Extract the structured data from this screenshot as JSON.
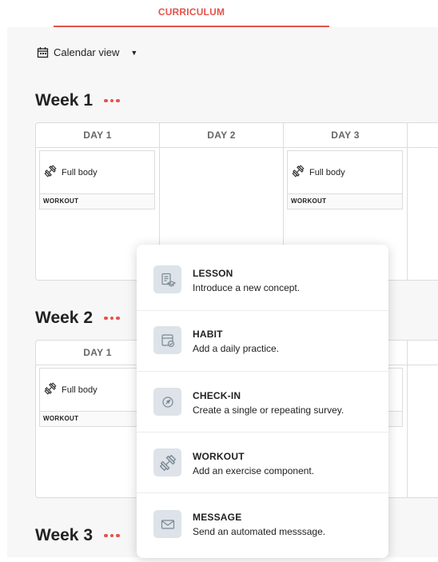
{
  "tab": {
    "label": "CURRICULUM",
    "accent": "#e5534b"
  },
  "view_selector": {
    "label": "Calendar view"
  },
  "weeks": [
    {
      "title": "Week 1",
      "days": [
        "DAY 1",
        "DAY 2",
        "DAY 3"
      ]
    },
    {
      "title": "Week 2",
      "days": [
        "DAY 1"
      ]
    },
    {
      "title": "Week 3"
    }
  ],
  "cards": {
    "w1d1": {
      "name": "Full body",
      "type": "WORKOUT"
    },
    "w1d3": {
      "name": "Full body",
      "type": "WORKOUT"
    },
    "w2d1": {
      "name": "Full body",
      "type": "WORKOUT"
    }
  },
  "menu": {
    "items": [
      {
        "title": "LESSON",
        "desc": "Introduce a new concept.",
        "icon": "lesson-icon"
      },
      {
        "title": "HABIT",
        "desc": "Add a daily practice.",
        "icon": "habit-icon"
      },
      {
        "title": "CHECK-IN",
        "desc": "Create a single or repeating survey.",
        "icon": "check-in-icon"
      },
      {
        "title": "WORKOUT",
        "desc": "Add an exercise component.",
        "icon": "workout-icon"
      },
      {
        "title": "MESSAGE",
        "desc": "Send an automated messsage.",
        "icon": "message-icon"
      }
    ]
  }
}
